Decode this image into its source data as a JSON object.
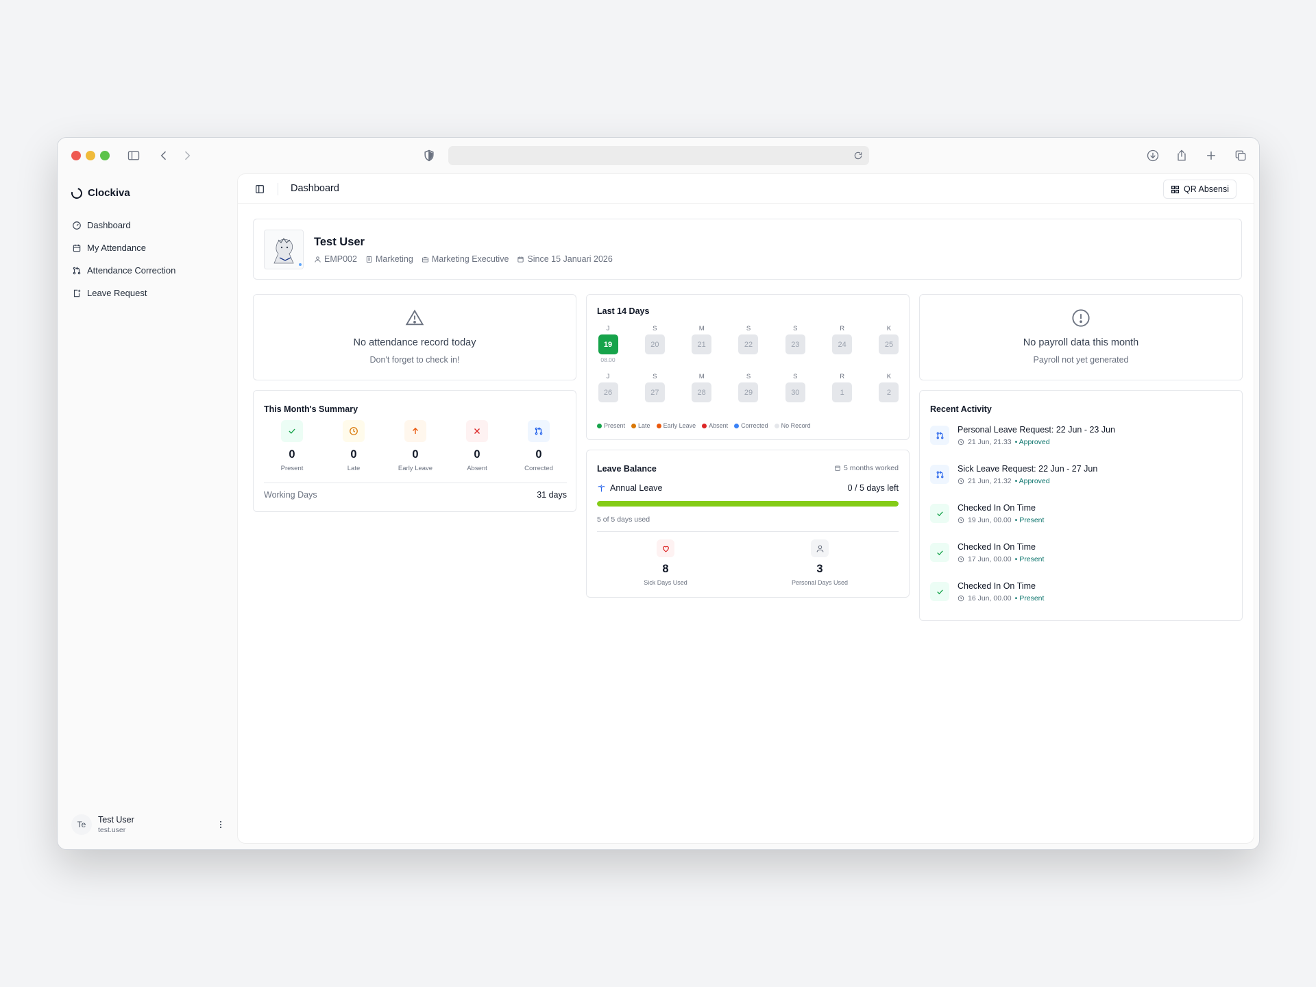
{
  "app": {
    "brand": "Clockiva",
    "page_title": "Dashboard",
    "qr_button": "QR Absensi"
  },
  "sidebar": {
    "items": [
      {
        "label": "Dashboard",
        "icon": "gauge-icon"
      },
      {
        "label": "My Attendance",
        "icon": "calendar-icon"
      },
      {
        "label": "Attendance Correction",
        "icon": "git-pull-request-icon"
      },
      {
        "label": "Leave Request",
        "icon": "leave-icon"
      }
    ],
    "user": {
      "initials": "Te",
      "name": "Test User",
      "handle": "test.user"
    }
  },
  "profile": {
    "name": "Test User",
    "employee_id": "EMP002",
    "department": "Marketing",
    "position": "Marketing Executive",
    "since": "Since 15 Januari 2026"
  },
  "today": {
    "title": "No attendance record today",
    "subtitle": "Don't forget to check in!"
  },
  "payroll": {
    "title": "No payroll data this month",
    "subtitle": "Payroll not yet generated"
  },
  "summary": {
    "title": "This Month's Summary",
    "items": [
      {
        "value": "0",
        "label": "Present",
        "color": "#16a34a",
        "bg": "#ecfdf5"
      },
      {
        "value": "0",
        "label": "Late",
        "color": "#d97706",
        "bg": "#fffbeb"
      },
      {
        "value": "0",
        "label": "Early Leave",
        "color": "#ea580c",
        "bg": "#fff7ed"
      },
      {
        "value": "0",
        "label": "Absent",
        "color": "#dc2626",
        "bg": "#fef2f2"
      },
      {
        "value": "0",
        "label": "Corrected",
        "color": "#2563eb",
        "bg": "#eff6ff"
      }
    ],
    "working_days_label": "Working Days",
    "working_days_value": "31 days"
  },
  "last14": {
    "title": "Last 14 Days",
    "rows": [
      [
        {
          "letter": "J",
          "day": "19",
          "status": "present",
          "time": "08.00"
        },
        {
          "letter": "S",
          "day": "20"
        },
        {
          "letter": "M",
          "day": "21"
        },
        {
          "letter": "S",
          "day": "22"
        },
        {
          "letter": "S",
          "day": "23"
        },
        {
          "letter": "R",
          "day": "24"
        },
        {
          "letter": "K",
          "day": "25"
        }
      ],
      [
        {
          "letter": "J",
          "day": "26"
        },
        {
          "letter": "S",
          "day": "27"
        },
        {
          "letter": "M",
          "day": "28"
        },
        {
          "letter": "S",
          "day": "29"
        },
        {
          "letter": "S",
          "day": "30"
        },
        {
          "letter": "R",
          "day": "1"
        },
        {
          "letter": "K",
          "day": "2"
        }
      ]
    ],
    "legend": [
      {
        "label": "Present",
        "color": "#16a34a"
      },
      {
        "label": "Late",
        "color": "#d97706"
      },
      {
        "label": "Early Leave",
        "color": "#ea580c"
      },
      {
        "label": "Absent",
        "color": "#dc2626"
      },
      {
        "label": "Corrected",
        "color": "#3b82f6"
      },
      {
        "label": "No Record",
        "color": "#e5e7eb"
      }
    ]
  },
  "leave": {
    "title": "Leave Balance",
    "worked": "5 months worked",
    "annual_label": "Annual Leave",
    "annual_value": "0 / 5 days left",
    "progress_fraction": 1.0,
    "used_text": "5 of 5 days used",
    "stats": [
      {
        "value": "8",
        "label": "Sick Days Used",
        "icon": "heart-icon",
        "color": "#dc2626",
        "bg": "#fef2f2"
      },
      {
        "value": "3",
        "label": "Personal Days Used",
        "icon": "user-icon",
        "color": "#6b7280",
        "bg": "#f3f4f6"
      }
    ]
  },
  "recent": {
    "title": "Recent Activity",
    "items": [
      {
        "title": "Personal Leave Request: 22 Jun - 23 Jun",
        "time": "21 Jun, 21.33",
        "status": "• Approved",
        "type": "request"
      },
      {
        "title": "Sick Leave Request: 22 Jun - 27 Jun",
        "time": "21 Jun, 21.32",
        "status": "• Approved",
        "type": "request"
      },
      {
        "title": "Checked In On Time",
        "time": "19 Jun, 00.00",
        "status": "• Present",
        "type": "check"
      },
      {
        "title": "Checked In On Time",
        "time": "17 Jun, 00.00",
        "status": "• Present",
        "type": "check"
      },
      {
        "title": "Checked In On Time",
        "time": "16 Jun, 00.00",
        "status": "• Present",
        "type": "check"
      }
    ]
  }
}
